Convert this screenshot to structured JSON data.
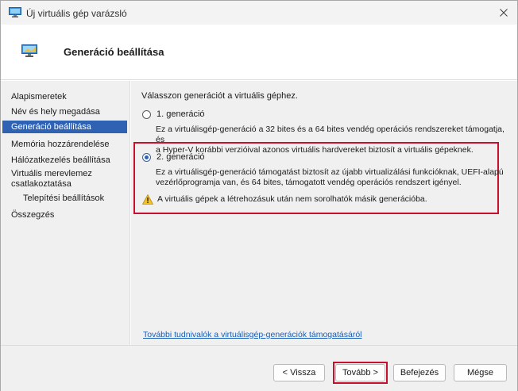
{
  "window": {
    "title": "Új virtuális gép varázsló",
    "icon": "monitor-icon"
  },
  "header": {
    "title": "Generáció beállítása",
    "icon": "monitor-icon"
  },
  "sidebar": {
    "items": [
      {
        "label": "Alapismeretek",
        "active": false
      },
      {
        "label": "Név és hely megadása",
        "active": false
      },
      {
        "label": "Generáció beállítása",
        "active": true
      },
      {
        "label": "Memória hozzárendelése",
        "active": false
      },
      {
        "label": "Hálózatkezelés beállítása",
        "active": false
      },
      {
        "label": "Virtuális merevlemez csatlakoztatása",
        "active": false
      },
      {
        "label": "Telepítési beállítások",
        "active": false
      },
      {
        "label": "Összegzés",
        "active": false
      }
    ]
  },
  "main": {
    "intro": "Válasszon generációt a virtuális géphez.",
    "gen1": {
      "label": "1. generáció",
      "selected": false,
      "desc_line1": "Ez a virtuálisgép-generáció a 32 bites és a 64 bites vendég operációs rendszereket támogatja, és",
      "desc_line2": "a Hyper-V korábbi verzióival azonos virtuális hardvereket biztosít a virtuális gépeknek."
    },
    "gen2": {
      "label": "2. generáció",
      "selected": true,
      "desc_line1": "Ez a virtuálisgép-generáció támogatást biztosít az újabb virtualizálási funkcióknak, UEFI-alapú",
      "desc_line2": "vezérlőprogramja van, és 64 bites, támogatott vendég operációs rendszert igényel."
    },
    "warning": {
      "icon": "warning-icon",
      "text": "A virtuális gépek a létrehozásuk után nem sorolhatók másik generációba."
    },
    "link": "További tudnivalók a virtuálisgép-generációk támogatásáról"
  },
  "footer": {
    "back": "< Vissza",
    "next": "Tovább >",
    "finish": "Befejezés",
    "cancel": "Mégse"
  },
  "colors": {
    "accent": "#2f62b3",
    "highlight": "#c8102e",
    "link": "#1a5fb4"
  }
}
